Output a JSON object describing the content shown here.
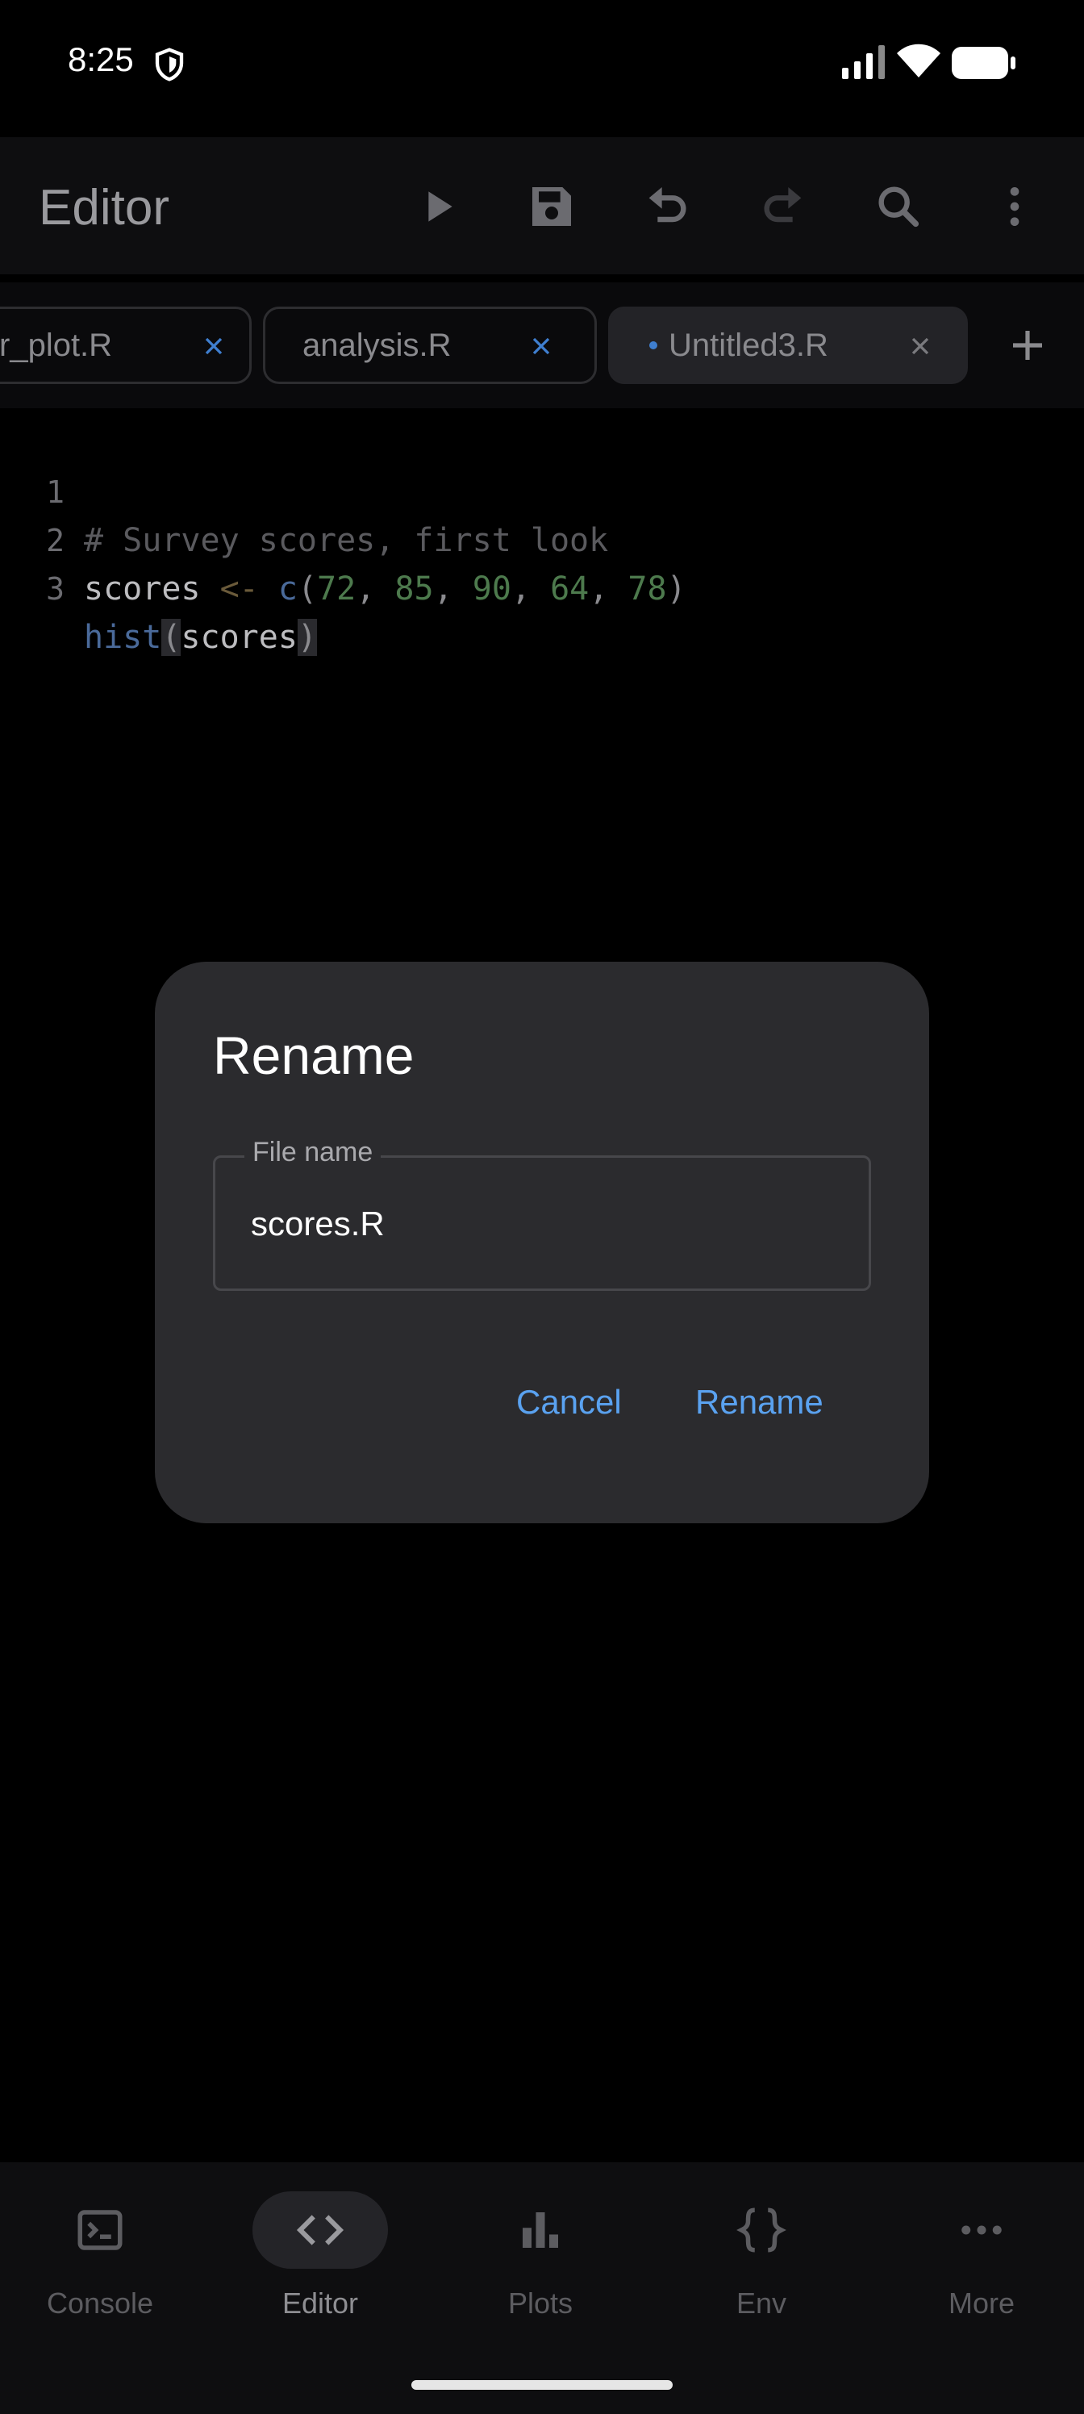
{
  "status": {
    "time": "8:25"
  },
  "app_bar": {
    "title": "Editor"
  },
  "tabs": [
    {
      "label": "r_plot.R",
      "active": false
    },
    {
      "label": "analysis.R",
      "active": false
    },
    {
      "label": "Untitled3.R",
      "active": true,
      "modified": true
    }
  ],
  "code": {
    "line_numbers": [
      "1",
      "2",
      "3"
    ],
    "line1": "# Survey scores, first look",
    "line2": {
      "var": "scores",
      "op": "<-",
      "fn": "c",
      "args": [
        "72",
        "85",
        "90",
        "64",
        "78"
      ],
      "sep": ", "
    },
    "line3": {
      "fn": "hist",
      "arg": "scores"
    }
  },
  "dialog": {
    "title": "Rename",
    "field_label": "File name",
    "field_value": "scores.R",
    "cancel_label": "Cancel",
    "confirm_label": "Rename"
  },
  "nav": {
    "items": [
      {
        "label": "Console",
        "icon": "console-icon"
      },
      {
        "label": "Editor",
        "icon": "code-icon",
        "active": true
      },
      {
        "label": "Plots",
        "icon": "bar-chart-icon"
      },
      {
        "label": "Env",
        "icon": "braces-icon"
      },
      {
        "label": "More",
        "icon": "more-horizontal-icon"
      }
    ]
  },
  "colors": {
    "accent": "#5aa2f0",
    "dialog_bg": "#2b2b2e",
    "background": "#000000"
  }
}
